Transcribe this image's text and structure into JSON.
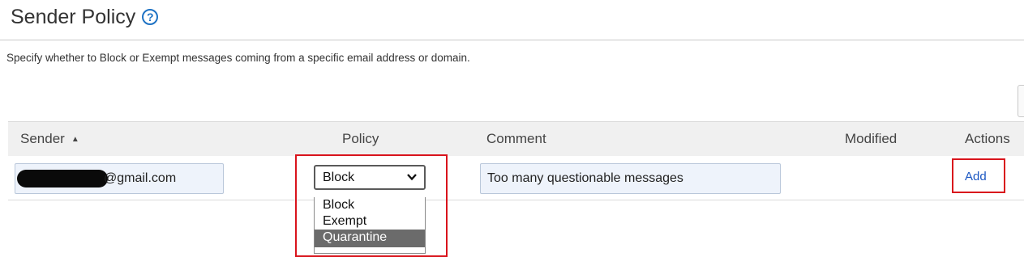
{
  "header": {
    "title": "Sender Policy",
    "help_glyph": "?"
  },
  "description": "Specify whether to Block or Exempt messages coming from a specific email address or domain.",
  "table": {
    "columns": {
      "sender": "Sender",
      "policy": "Policy",
      "comment": "Comment",
      "modified": "Modified",
      "actions": "Actions"
    },
    "sort": {
      "column": "Sender",
      "direction": "ascending",
      "icon": "sort-up-icon"
    }
  },
  "new_row": {
    "sender_visible_suffix": "@gmail.com",
    "sender_redacted": true,
    "policy_selected": "Block",
    "comment": "Too many questionable messages",
    "modified": "",
    "action_label": "Add"
  },
  "policy_dropdown": {
    "open": true,
    "options": [
      "Block",
      "Exempt",
      "Quarantine"
    ],
    "highlighted": "Quarantine"
  },
  "highlight_color": "#d9141c",
  "link_color": "#1a56c2"
}
